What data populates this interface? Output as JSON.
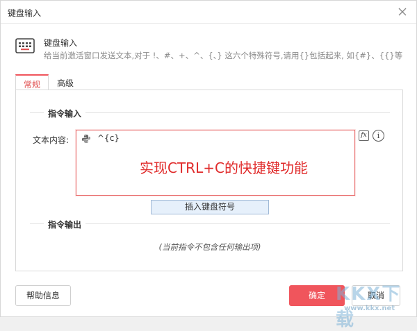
{
  "dialog": {
    "title": "键盘输入",
    "close_icon": "close-icon"
  },
  "header": {
    "icon": "keyboard-icon",
    "title": "键盘输入",
    "description": "给当前激活窗口发送文本,对于 !、#、+、^、{、} 这六个特殊符号,请用{}包括起来, 如{#}、{{}等"
  },
  "tabs": [
    {
      "label": "常规",
      "active": true
    },
    {
      "label": "高级",
      "active": false
    }
  ],
  "input_section": {
    "title": "指令输入",
    "field_label": "文本内容:",
    "text_value": "^{c}",
    "language_icon": "python-icon",
    "annotation": "实现CTRL+C的快捷键功能",
    "fx_label": "fx",
    "info_label": "i",
    "insert_button": "插入键盘符号"
  },
  "output_section": {
    "title": "指令输出",
    "empty_message": "(当前指令不包含任何输出项)"
  },
  "footer": {
    "help_label": "帮助信息",
    "ok_label": "确定",
    "cancel_label": "取消"
  },
  "watermark": {
    "logo": "KKX下载",
    "url": "www.kkx.net"
  },
  "colors": {
    "accent": "#f0555c",
    "annotation": "#e02a2a",
    "insert_bg": "#e6f0fb"
  }
}
